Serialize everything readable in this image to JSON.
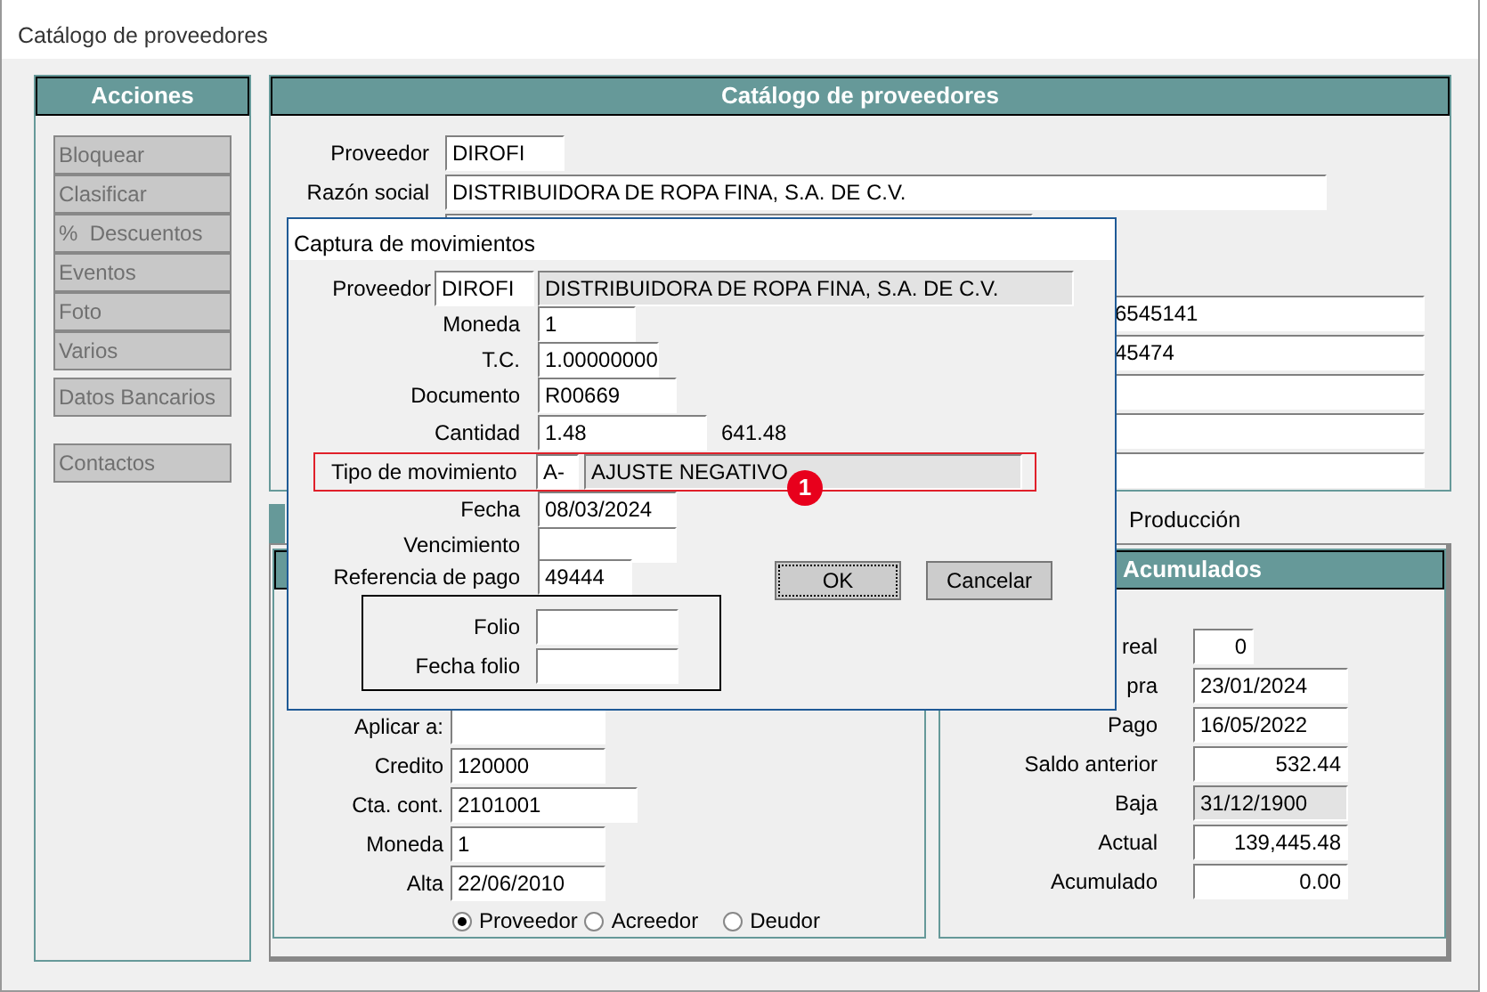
{
  "window": {
    "title": "Catálogo de proveedores"
  },
  "actions_panel": {
    "title": "Acciones",
    "button_groups": [
      [
        {
          "label": "Bloquear",
          "disabled": true
        },
        {
          "label": "Clasificar",
          "disabled": true
        },
        {
          "label": "%  Descuentos",
          "disabled": true
        },
        {
          "label": "Eventos",
          "disabled": true
        },
        {
          "label": "Foto",
          "disabled": true
        },
        {
          "label": "Varios",
          "disabled": true
        }
      ],
      [
        {
          "label": "Datos Bancarios",
          "disabled": true
        }
      ],
      [
        {
          "label": "Contactos",
          "disabled": true
        }
      ]
    ]
  },
  "catalog_panel": {
    "title": "Catálogo de proveedores",
    "fields": [
      {
        "label": "Proveedor",
        "value": "DIROFI"
      },
      {
        "label": "Razón social",
        "value": "DISTRIBUIDORA DE ROPA FINA, S.A. DE C.V."
      },
      {
        "kind": "blank"
      }
    ],
    "right_fields": [
      {
        "value": "6545141"
      },
      {
        "value": "45474"
      },
      {
        "kind": "blank"
      },
      {
        "kind": "blank"
      },
      {
        "kind": "blank"
      }
    ]
  },
  "tabs": [
    {
      "label": "Producción"
    }
  ],
  "general_panel": {
    "fields": [
      {
        "label": "Aplicar a:"
      },
      {
        "label": "Credito",
        "value": "120000"
      },
      {
        "label": "Cta. cont.",
        "value": "2101001"
      },
      {
        "label": "Moneda",
        "value": "1"
      },
      {
        "label": "Alta",
        "value": "22/06/2010"
      }
    ],
    "radios": [
      {
        "label": "Proveedor",
        "selected": true
      },
      {
        "label": "Acreedor",
        "selected": false
      },
      {
        "label": "Deudor",
        "selected": false
      }
    ]
  },
  "accumulated_panel": {
    "title": "Acumulados",
    "fields": [
      {
        "label": "real",
        "value": "0",
        "kind": "count"
      },
      {
        "label": "pra",
        "value": "23/01/2024",
        "kind": "date"
      },
      {
        "label": "Pago",
        "value": "16/05/2022",
        "kind": "date"
      },
      {
        "label": "Saldo anterior",
        "value": "532.44",
        "kind": "number"
      },
      {
        "label": "Baja",
        "value": "31/12/1900",
        "kind": "readonly"
      },
      {
        "label": "Actual",
        "value": "139,445.48",
        "kind": "number"
      },
      {
        "label": "Acumulado",
        "value": "0.00",
        "kind": "number"
      }
    ]
  },
  "dialog": {
    "title": "Captura de movimientos",
    "rows": [
      {
        "label": "Proveedor",
        "fields": [
          {
            "value": "DIROFI",
            "kind": "edit"
          },
          {
            "value": "DISTRIBUIDORA DE ROPA FINA, S.A. DE C.V.",
            "kind": "readonly"
          }
        ]
      },
      {
        "label": "Moneda",
        "fields": [
          {
            "value": "1",
            "kind": "edit"
          }
        ]
      },
      {
        "label": "T.C.",
        "fields": [
          {
            "value": "1.00000000",
            "kind": "edit"
          }
        ]
      },
      {
        "label": "Documento",
        "fields": [
          {
            "value": "R00669",
            "kind": "edit"
          }
        ]
      },
      {
        "label": "Cantidad",
        "fields": [
          {
            "value": "1.48",
            "kind": "edit"
          }
        ],
        "note": "641.48"
      },
      {
        "label": "Tipo de movimiento",
        "highlighted": true,
        "fields": [
          {
            "value": "A-",
            "kind": "edit"
          },
          {
            "value": "AJUSTE NEGATIVO",
            "kind": "readonly"
          }
        ]
      },
      {
        "label": "Fecha",
        "fields": [
          {
            "value": "08/03/2024",
            "kind": "edit"
          }
        ]
      },
      {
        "label": "Vencimiento",
        "fields": [
          {
            "kind": "edit"
          }
        ]
      },
      {
        "label": "Referencia de pago",
        "fields": [
          {
            "value": "49444",
            "kind": "edit"
          }
        ]
      }
    ],
    "folio_group": [
      {
        "label": "Folio"
      },
      {
        "label": "Fecha folio"
      }
    ],
    "buttons": [
      {
        "label": "OK",
        "focused": true
      },
      {
        "label": "Cancelar",
        "focused": false
      }
    ]
  },
  "annotation": {
    "label": "1"
  }
}
